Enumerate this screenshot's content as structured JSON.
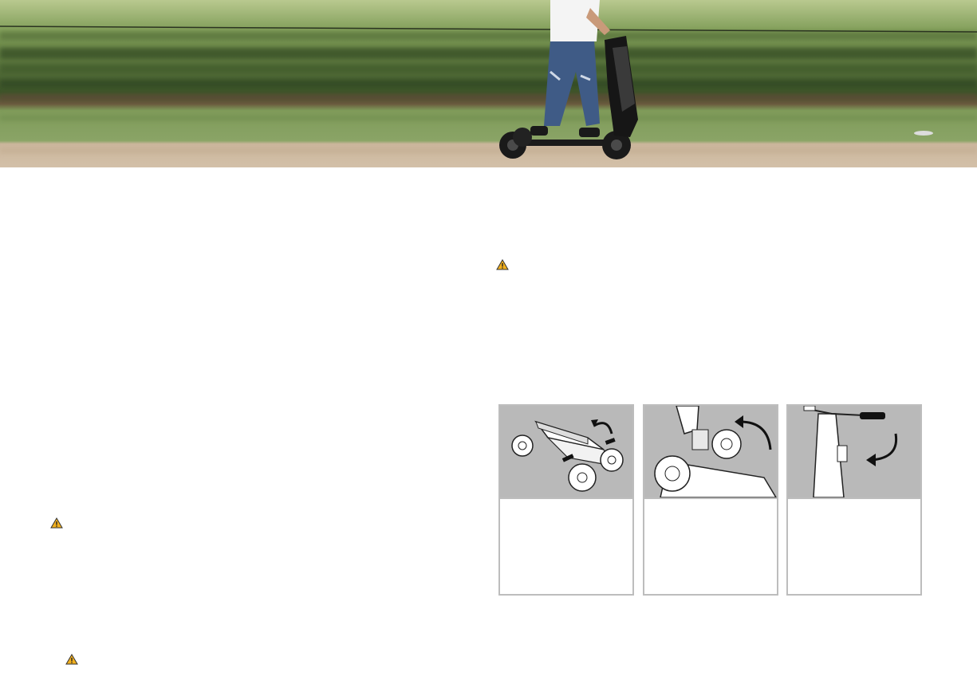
{
  "hero": {
    "photo": "rider-on-four-wheel-electric-skateboard",
    "colors": {
      "hedge": "#3f5a2a",
      "grass": "#7e9a5c",
      "path": "#cdb79d",
      "sky": "#9fb67a"
    }
  },
  "warnings": [
    {
      "icon": "warning-triangle-icon",
      "color": "#f2b01e"
    },
    {
      "icon": "warning-triangle-icon",
      "color": "#f2b01e"
    },
    {
      "icon": "warning-triangle-icon",
      "color": "#f2b01e"
    }
  ],
  "steps": [
    {
      "illustration": "unfold-stem-step-1",
      "caption": ""
    },
    {
      "illustration": "lift-stem-step-2",
      "caption": ""
    },
    {
      "illustration": "fold-handlebar-step-3",
      "caption": ""
    }
  ]
}
